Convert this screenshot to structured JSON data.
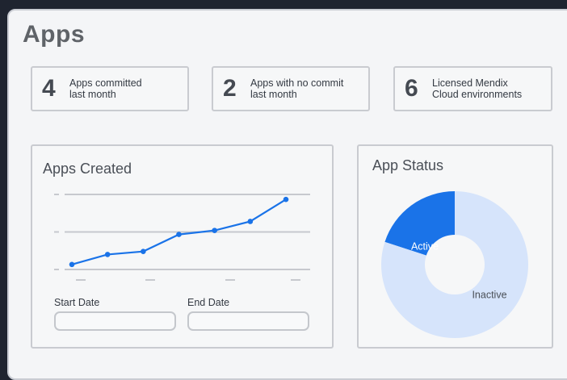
{
  "page": {
    "title": "Apps"
  },
  "stats": [
    {
      "value": "4",
      "label": "Apps committed\nlast month"
    },
    {
      "value": "2",
      "label": "Apps with no commit\nlast month"
    },
    {
      "value": "6",
      "label": "Licensed Mendix\nCloud environments"
    }
  ],
  "apps_created": {
    "title": "Apps Created",
    "start_label": "Start Date",
    "end_label": "End Date",
    "start_value": "",
    "end_value": ""
  },
  "app_status": {
    "title": "App Status",
    "active_label": "Active",
    "inactive_label": "Inactive"
  },
  "colors": {
    "accent": "#1a73e8",
    "donut_light": "#d6e4fb",
    "grid": "#c7c9ce"
  },
  "chart_data": [
    {
      "type": "line",
      "title": "Apps Created",
      "x": [
        1,
        2,
        3,
        4,
        5,
        6,
        7
      ],
      "series": [
        {
          "values": [
            0.5,
            1.5,
            1.8,
            3.5,
            3.9,
            4.8,
            7.0
          ]
        }
      ],
      "ylim": [
        0,
        7.5
      ],
      "grid": true,
      "gridlines": 3
    },
    {
      "type": "pie",
      "title": "App Status",
      "categories": [
        "Active",
        "Inactive"
      ],
      "values": [
        20,
        80
      ],
      "donut": true
    }
  ]
}
